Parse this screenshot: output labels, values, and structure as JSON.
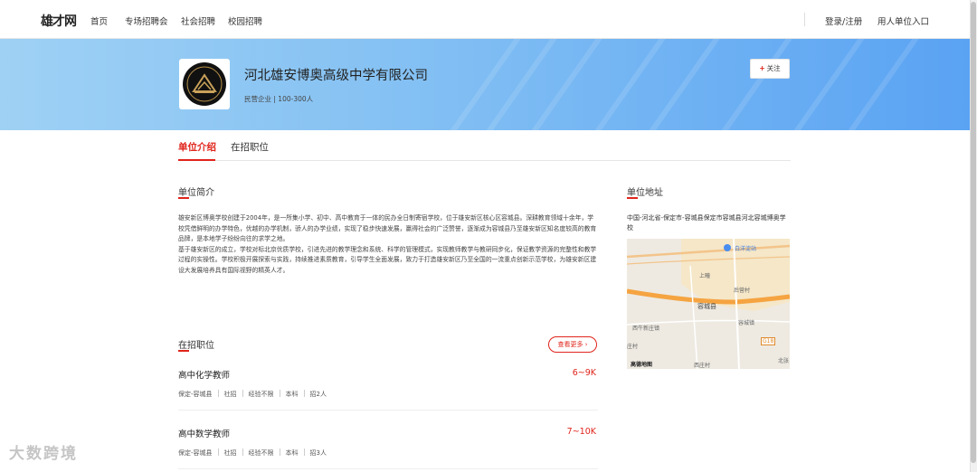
{
  "nav": {
    "logo": "雄才网",
    "items": [
      "首页",
      "专场招聘会",
      "社会招聘",
      "校园招聘"
    ],
    "login": "登录/注册",
    "employer": "用人单位入口"
  },
  "company": {
    "name": "河北雄安博奥高级中学有限公司",
    "meta": "民营企业 | 100-300人",
    "follow": "关注"
  },
  "tabs": [
    "单位介绍",
    "在招职位"
  ],
  "intro": {
    "title": "单位简介",
    "text": "雄安新区博奥学校创建于2004年，是一所集小学、初中、高中教育于一体的民办全日制寄宿学校，位于雄安新区核心区容城县。深耕教育领域十余年，学校凭借鲜明的办学特色，优越的办学机制，骄人的办学业绩，实现了稳步快速发展，赢得社会的广泛赞誉，逐渐成为容城县乃至雄安新区知名度较高的教育品牌，是本地学子纷纷向往的求学之地。\n基于雄安新区的成立，学校对标北京优质学校，引进先进的教学理念和系统、科学的管理模式，实现教师教学与教研同步化，保证教学资源的完整性和教学过程的实操性。学校积极开展探索与实践，持续推进素质教育，引导学生全面发展，致力于打造雄安新区乃至全国的一流重点创新示范学校，为雄安新区建设大发展培养具有国际视野的精英人才。"
  },
  "jobs_section": {
    "title": "在招职位",
    "see_more": "查看更多"
  },
  "jobs": [
    {
      "title": "高中化学教师",
      "salary": "6~9K",
      "tags": [
        "保定-容城县",
        "社招",
        "经验不限",
        "本科",
        "招2人"
      ]
    },
    {
      "title": "高中数学教师",
      "salary": "7~10K",
      "tags": [
        "保定-容城县",
        "社招",
        "经验不限",
        "本科",
        "招3人"
      ]
    }
  ],
  "address": {
    "title": "单位地址",
    "text": "中国-河北省-保定市-容城县保定市容城县河北容城博奥学校",
    "map_labels": {
      "poi": "白洋淀站",
      "shangju": "上疃",
      "housu": "后营村",
      "rongcheng": "容城县",
      "rongchengzhen": "容城镇",
      "xiniu": "西牛新庄镇",
      "village": "西庄村",
      "road": "G18",
      "brand": "高德地图",
      "bei": "北张",
      "s": "庄村"
    }
  },
  "watermark": "大数跨境",
  "colors": {
    "accent": "#e0241b",
    "banner_start": "#9fd1f4",
    "banner_end": "#5aa3f3"
  }
}
